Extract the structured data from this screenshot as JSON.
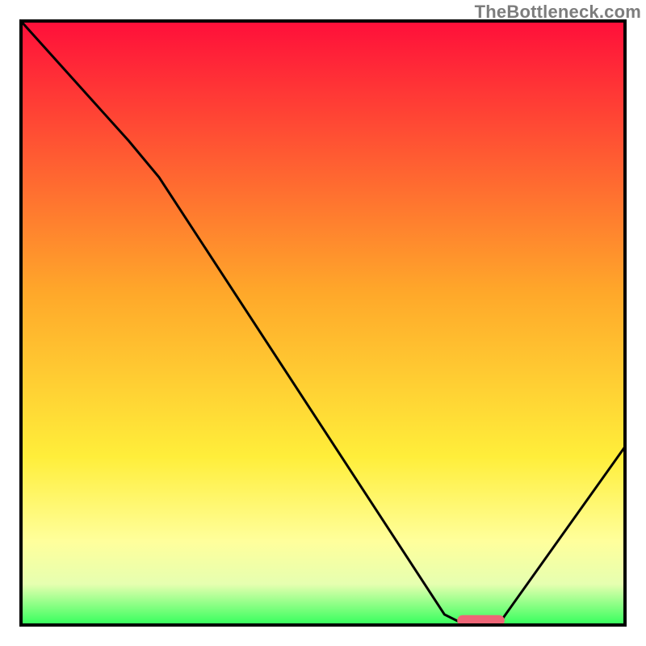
{
  "watermark": "TheBottleneck.com",
  "chart_data": {
    "type": "line",
    "title": "",
    "xlabel": "",
    "ylabel": "",
    "xlim": [
      0,
      100
    ],
    "ylim": [
      0,
      100
    ],
    "gradient": {
      "stops": [
        {
          "offset": 0.0,
          "color": "#ff0e3a"
        },
        {
          "offset": 0.45,
          "color": "#ffa82a"
        },
        {
          "offset": 0.72,
          "color": "#ffee3a"
        },
        {
          "offset": 0.86,
          "color": "#ffff9c"
        },
        {
          "offset": 0.93,
          "color": "#e6ffb0"
        },
        {
          "offset": 1.0,
          "color": "#2cff58"
        }
      ]
    },
    "curve": [
      {
        "x": 0,
        "y": 100
      },
      {
        "x": 18,
        "y": 80
      },
      {
        "x": 23,
        "y": 74
      },
      {
        "x": 70,
        "y": 2
      },
      {
        "x": 73,
        "y": 0.5
      },
      {
        "x": 79,
        "y": 0.5
      },
      {
        "x": 100,
        "y": 30
      }
    ],
    "marker": {
      "x_start": 73,
      "x_end": 79,
      "y": 1.0,
      "color": "#ee6677",
      "thickness": 1.8
    }
  }
}
